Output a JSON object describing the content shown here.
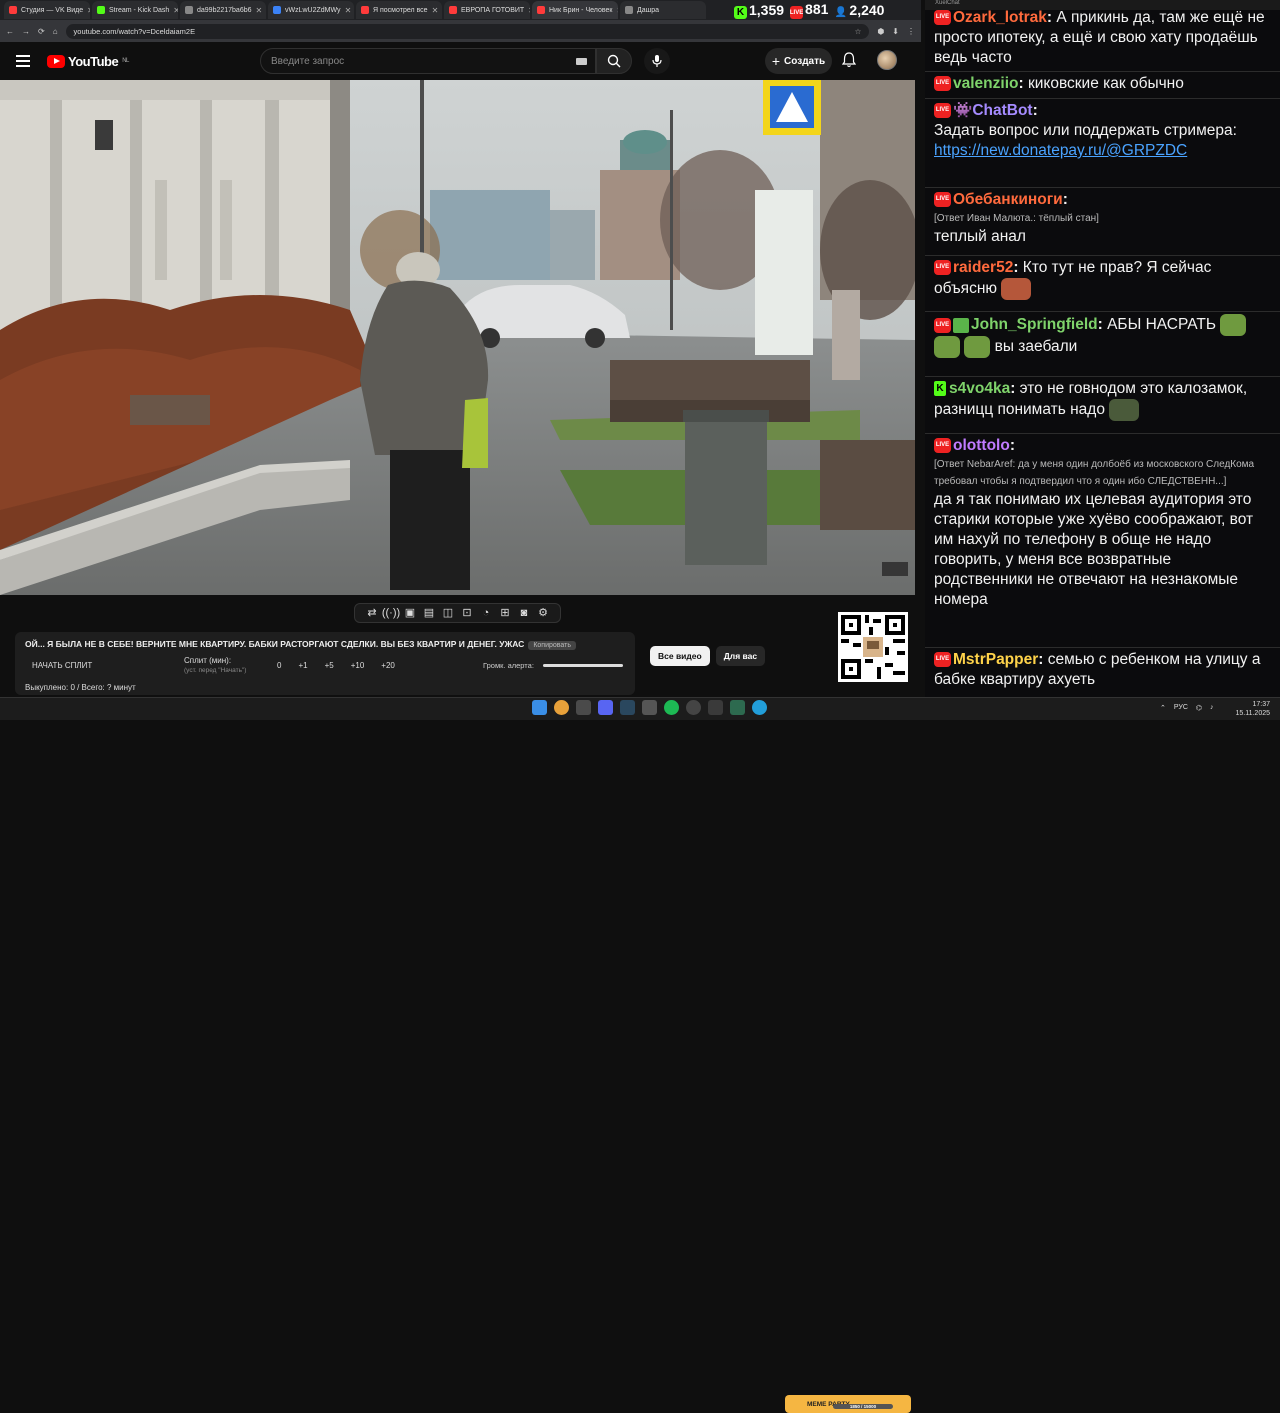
{
  "browser": {
    "tabs": [
      {
        "title": "Студия — VK Виде",
        "color": "#ff3b3b"
      },
      {
        "title": "Stream - Kick Dash",
        "color": "#53fc18"
      },
      {
        "title": "da99b2217ba6b6",
        "color": "#888888"
      },
      {
        "title": "vWzLwU2ZdMWy",
        "color": "#3b82f6"
      },
      {
        "title": "Я посмотрел все",
        "color": "#ff3b3b"
      },
      {
        "title": "ЕВРОПА ГОТОВИТ",
        "color": "#ff3b3b"
      },
      {
        "title": "Ник Брин - Человек",
        "color": "#ff3b3b"
      },
      {
        "title": "Дашра",
        "color": "#888888"
      }
    ],
    "url": "youtube.com/watch?v=Dceldaiam2E"
  },
  "stream_stats": {
    "kick": "1,359",
    "vk": "881",
    "viewers": "2,240"
  },
  "youtube": {
    "logo": "YouTube",
    "region": "NL",
    "search_placeholder": "Введите запрос",
    "create_label": "Создать"
  },
  "overlay": {
    "title": "ОЙ... Я БЫЛА НЕ В СЕБЕ! ВЕРНИТЕ МНЕ КВАРТИРУ. БАБКИ РАСТОРГАЮТ СДЕЛКИ. ВЫ БЕЗ КВАРТИР И ДЕНЕГ. УЖАС",
    "copy_label": "Копировать",
    "start_split": "НАЧАТЬ СПЛИТ",
    "split_label": "Сплит (мин):",
    "split_sub": "(уст. перед \"Начать\")",
    "split_values": [
      "0",
      "+1",
      "+5",
      "+10",
      "+20"
    ],
    "volume_label": "Громк. алерта:",
    "result": "Выкуплено: 0 / Всего: ? минут"
  },
  "chips": [
    "Все видео",
    "Для вас"
  ],
  "chat": {
    "window_title": "XuelChat",
    "messages": [
      {
        "user": "Ozark_lotrak",
        "color": "#ff6a3d",
        "badge": "live",
        "text": "А прикинь да, там же ещё не просто ипотеку, а ещё и свою хату продаёшь ведь часто"
      },
      {
        "user": "valenziio",
        "color": "#7fd36b",
        "badge": "live",
        "text": "киковские как обычно"
      },
      {
        "user": "ChatBot",
        "color": "#a58bff",
        "badge": "live",
        "text": "Задать вопрос или поддержать стримера:",
        "link": "https://new.donatepay.ru/@GRPZDC"
      },
      {
        "user": "Обебанкиноги",
        "color": "#ff6a3d",
        "badge": "live",
        "reply": "[Ответ Иван Малюта.: тёплый стан]",
        "text": "теплый анал"
      },
      {
        "user": "raider52",
        "color": "#ff6a3d",
        "badge": "live",
        "text": "Кто тут не прав? Я сейчас объясню"
      },
      {
        "user": "John_Springfield",
        "color": "#7fd36b",
        "badge": "live",
        "text": "АБЫ НАСРАТЬ",
        "text2": "вы заебали"
      },
      {
        "user": "s4vo4ka",
        "color": "#7fd36b",
        "badge": "kick",
        "text": "это не говнодом это калозамок, разницц понимать надо"
      },
      {
        "user": "olottolo",
        "color": "#c07bff",
        "badge": "live",
        "reply": "[Ответ NebarAref: да у меня один долбоёб из московского СледКома требовал чтобы я подтвердил что я один ибо СЛЕДСТВЕНН...]",
        "text": "да я так понимаю их целевая аудитория это старики которые уже хуёво соображают, вот им нахуй по телефону в обще не надо говорить, у меня все возвратные родственники не отвечают на незнакомые номера"
      },
      {
        "user": "MstrPapper",
        "color": "#ffd34a",
        "badge": "live",
        "text": "семью с ребенком на улицу а бабке квартиру ахуеть"
      }
    ]
  },
  "taskbar": {
    "lang": "РУС",
    "time": "17:37",
    "date": "15.11.2025",
    "banner": "MEME PARTY",
    "banner_progress": "1850 / 15000"
  }
}
